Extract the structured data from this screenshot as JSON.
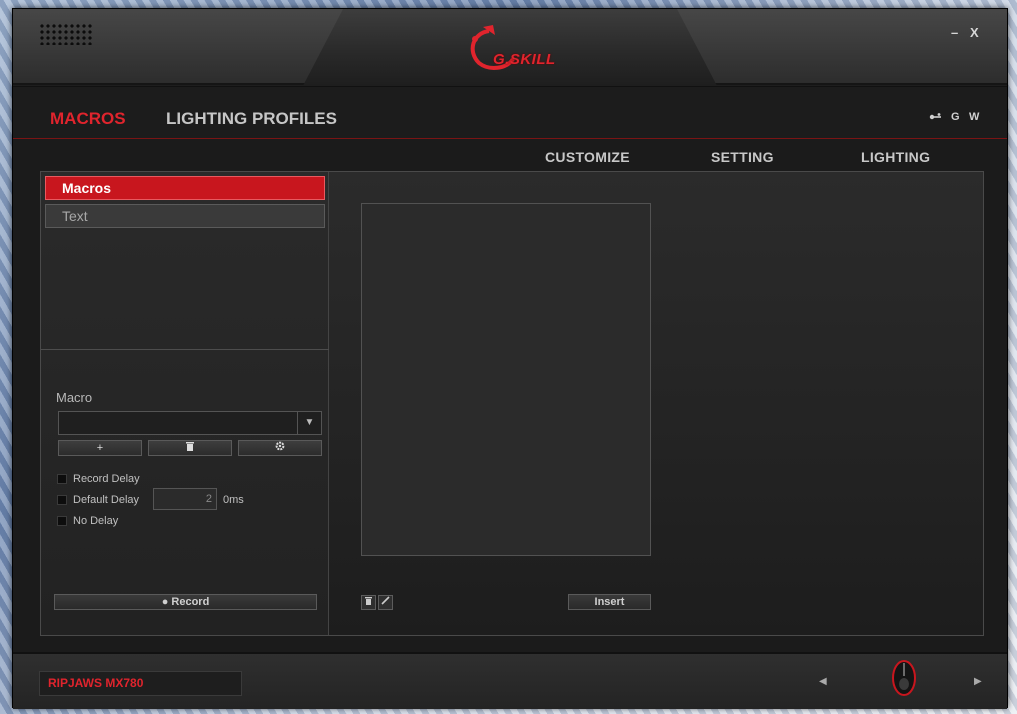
{
  "window": {
    "brand": "G.SKILL",
    "minimize_label": "–",
    "close_label": "X"
  },
  "nav": {
    "tabs": [
      {
        "label": "MACROS",
        "active": true
      },
      {
        "label": "LIGHTING PROFILES",
        "active": false
      }
    ],
    "social": [
      "G",
      "W"
    ]
  },
  "subnav": [
    "CUSTOMIZE",
    "SETTING",
    "LIGHTING"
  ],
  "sidebar": {
    "tabs": [
      {
        "label": "Macros",
        "active": true
      },
      {
        "label": "Text",
        "active": false
      }
    ]
  },
  "macro": {
    "section_label": "Macro",
    "selected": "",
    "buttons": [
      "+",
      "🗑",
      "⚙"
    ],
    "options": {
      "record_delay": "Record Delay",
      "default_delay": "Default Delay",
      "no_delay": "No Delay"
    },
    "default_delay_value": "2",
    "delay_unit": "0ms",
    "record_label": "● Record"
  },
  "editor": {
    "insert_label": "Insert"
  },
  "footer": {
    "device_name": "RIPJAWS MX780"
  },
  "colors": {
    "accent": "#e0242d",
    "active_tab": "#c8161e"
  }
}
